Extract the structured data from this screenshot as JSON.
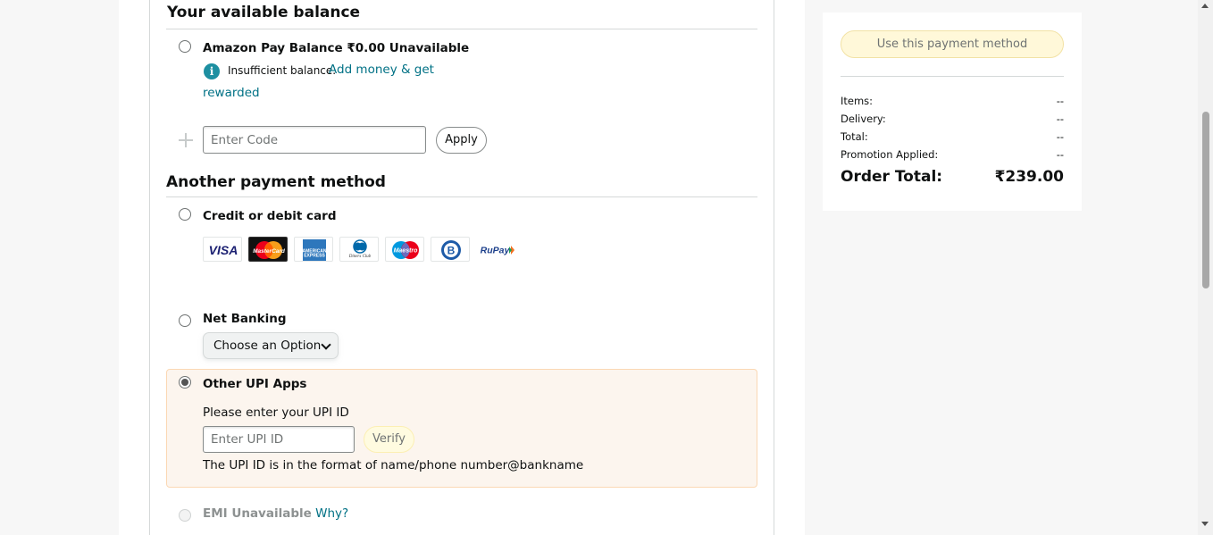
{
  "balance_section": {
    "title": "Your available balance",
    "amazon_pay_label": "Amazon Pay Balance ₹0.00 Unavailable",
    "info_icon": "info-icon",
    "insufficient_text": "Insufficient balance.",
    "add_money_link_line1": "Add money & get",
    "add_money_link_line2": "rewarded",
    "code_placeholder": "Enter Code",
    "apply_label": "Apply"
  },
  "another_section": {
    "title": "Another payment method",
    "card_label": "Credit or debit card",
    "card_logos": [
      "VISA",
      "MasterCard",
      "American Express",
      "Diners Club International",
      "Maestro",
      "Bajaj Finserv",
      "RuPay"
    ],
    "net_banking_label": "Net Banking",
    "net_banking_select": "Choose an Option",
    "upi_label": "Other UPI Apps",
    "upi_prompt": "Please enter your UPI ID",
    "upi_placeholder": "Enter UPI ID",
    "verify_label": "Verify",
    "upi_hint": "The UPI ID is in the format of name/phone number@bankname",
    "emi_label": "EMI Unavailable",
    "emi_why": "Why?"
  },
  "summary": {
    "use_button": "Use this payment method",
    "rows": [
      {
        "label": "Items:",
        "value": "--"
      },
      {
        "label": "Delivery:",
        "value": "--"
      },
      {
        "label": "Total:",
        "value": "--"
      },
      {
        "label": "Promotion Applied:",
        "value": "--"
      }
    ],
    "order_total_label": "Order Total:",
    "order_total_value": "₹239.00"
  },
  "colors": {
    "link": "#007185",
    "upi_highlight_bg": "#fcf5ee",
    "upi_highlight_border": "#fbd8b4",
    "use_button_bg": "#fff8d9"
  }
}
